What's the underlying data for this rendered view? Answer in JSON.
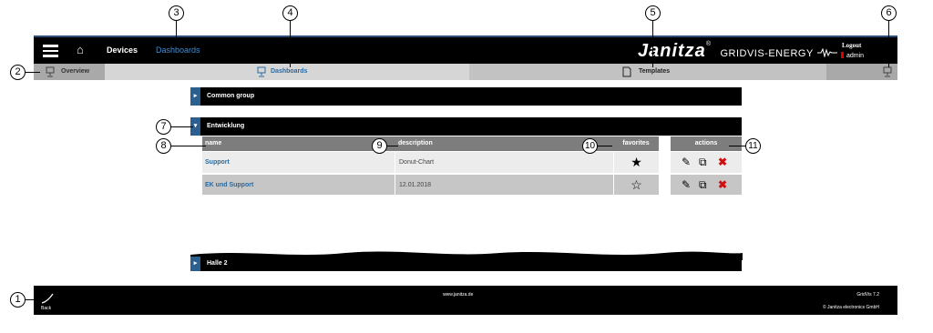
{
  "topbar": {
    "nav_devices": "Devices",
    "nav_dashboards": "Dashboards",
    "brand_name": "Janitza",
    "brand_suffix": "GRIDVIS-ENERGY",
    "logout": "Logout",
    "user": "admin"
  },
  "tabs": {
    "overview": "Overview",
    "dashboards": "Dashboards",
    "templates": "Templates"
  },
  "groups": {
    "common": "Common group",
    "entwicklung": "Entwicklung",
    "halle": "Halle 2"
  },
  "table": {
    "headers": {
      "name": "name",
      "description": "description",
      "favorites": "favorites",
      "actions": "actions"
    },
    "rows": [
      {
        "name": "Support",
        "description": "Donut-Chart",
        "favorite": true
      },
      {
        "name": "EK und Support",
        "description": "12.01.2018",
        "favorite": false
      }
    ]
  },
  "footer": {
    "back": "Back",
    "url": "www.janitza.de",
    "version": "GridVis 7.2",
    "copyright": "© Janitza electronics GmbH"
  },
  "callouts": [
    "1",
    "2",
    "3",
    "4",
    "5",
    "6",
    "7",
    "8",
    "9",
    "10",
    "11"
  ],
  "colors": {
    "accent": "#3f8fd6",
    "link": "#2a6aa0",
    "delete": "#d01010",
    "bar": "#000000"
  }
}
